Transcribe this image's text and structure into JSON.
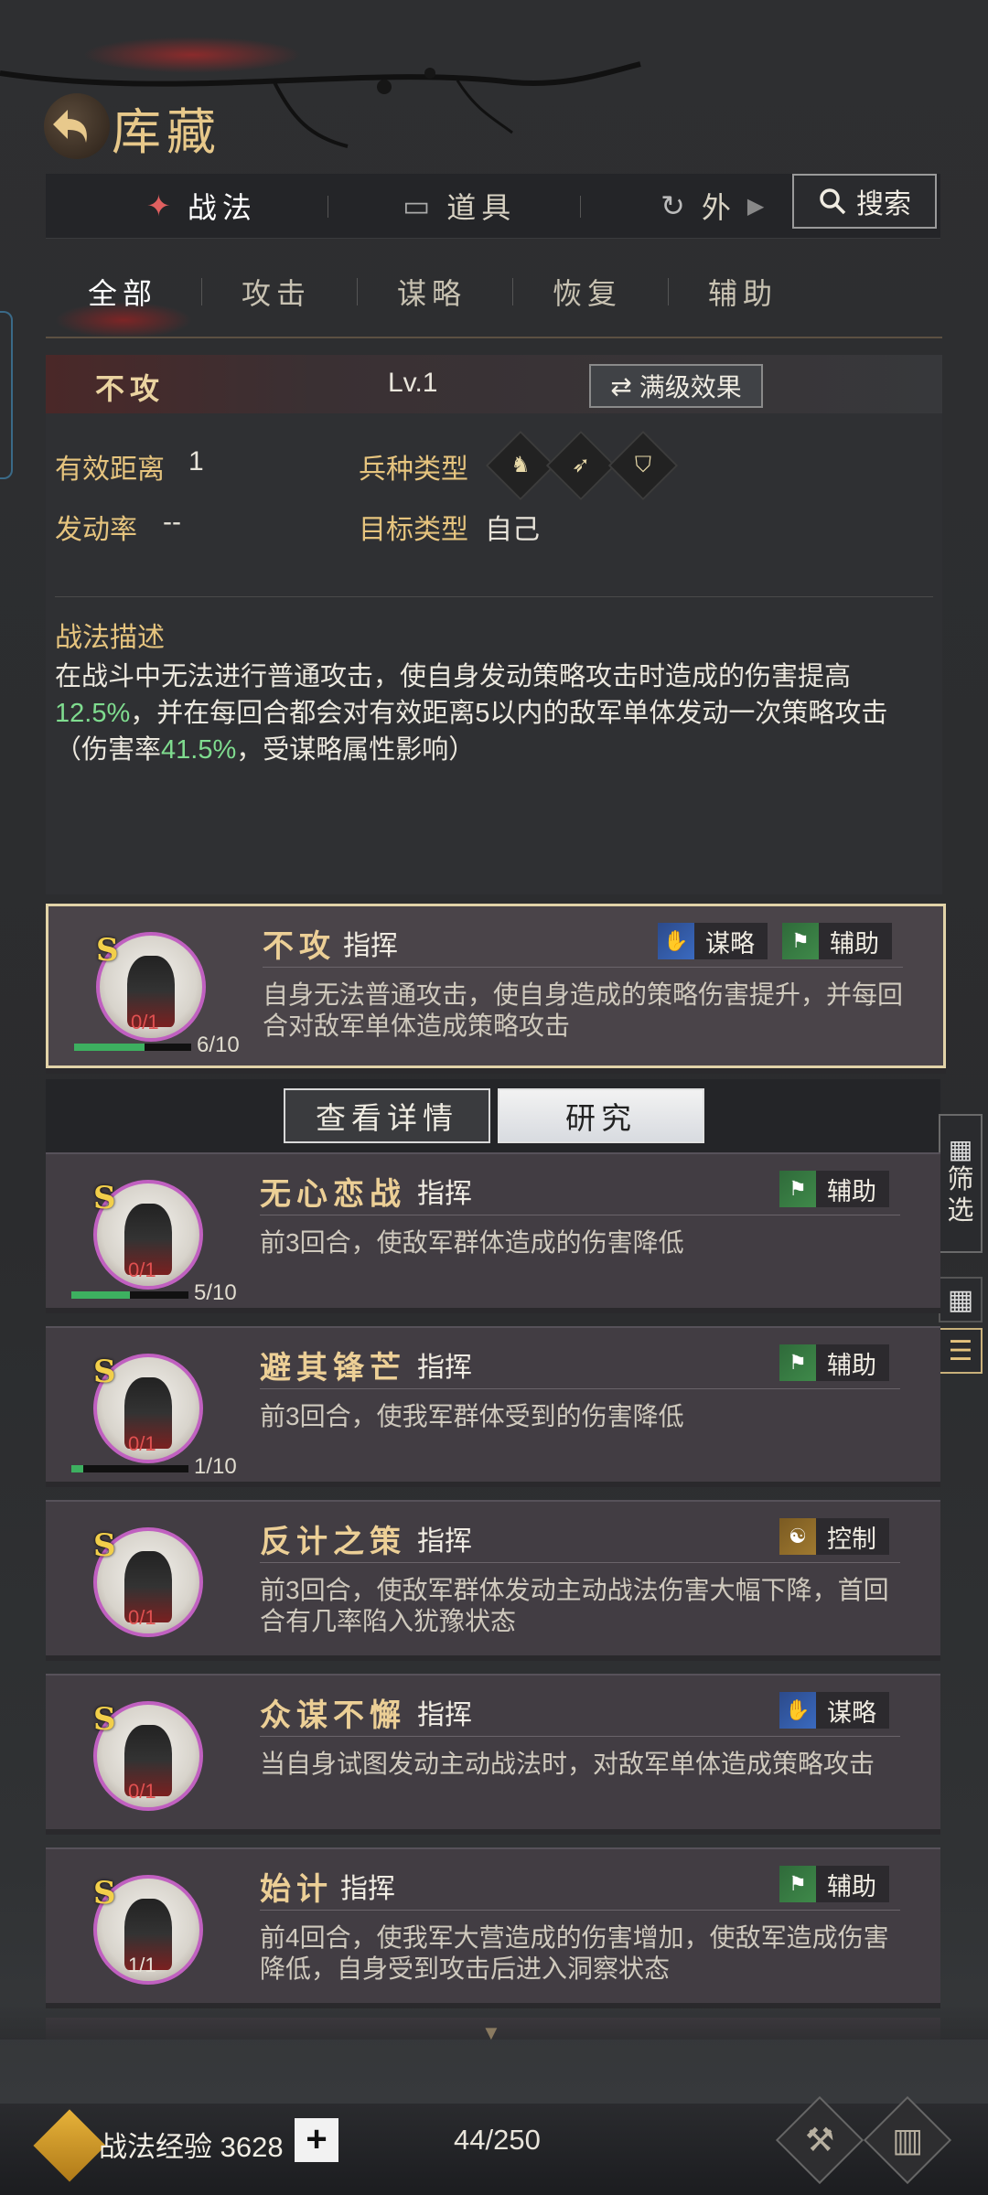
{
  "header": {
    "title": "库藏"
  },
  "tabs": [
    {
      "label": "战法",
      "icon": "scroll-icon"
    },
    {
      "label": "道具",
      "icon": "chest-icon"
    },
    {
      "label": "外",
      "icon": "cycle-icon"
    }
  ],
  "search": {
    "label": "搜索"
  },
  "subtabs": [
    "全部",
    "攻击",
    "谋略",
    "恢复",
    "辅助"
  ],
  "detail": {
    "name": "不攻",
    "level": "Lv.1",
    "max_effect": "满级效果",
    "range_label": "有效距离",
    "range_value": "1",
    "troop_label": "兵种类型",
    "rate_label": "发动率",
    "rate_value": "--",
    "target_label": "目标类型",
    "target_value": "自己",
    "desc_title": "战法描述",
    "desc_part1": "在战斗中无法进行普通攻击，使自身发动策略攻击时造成的伤害提高",
    "desc_hl1": "12.5%",
    "desc_part2": "，并在每回合都会对有效距离5以内的敌军单体发动一次策略攻击（伤害率",
    "desc_hl2": "41.5%",
    "desc_part3": "，受谋略属性影响）"
  },
  "actions": {
    "details": "查看详情",
    "research": "研究"
  },
  "filter": {
    "label": "筛选"
  },
  "cards": [
    {
      "grade": "S",
      "name": "不攻",
      "type": "指挥",
      "count": "0/1",
      "progress_label": "6/10",
      "progress": 0.6,
      "tags": [
        {
          "label": "谋略",
          "color": "blue"
        },
        {
          "label": "辅助",
          "color": "green"
        }
      ],
      "desc": "自身无法普通攻击，使自身造成的策略伤害提升，并每回合对敌军单体造成策略攻击"
    },
    {
      "grade": "S",
      "name": "无心恋战",
      "type": "指挥",
      "count": "0/1",
      "progress_label": "5/10",
      "progress": 0.5,
      "tags": [
        {
          "label": "辅助",
          "color": "green"
        }
      ],
      "desc": "前3回合，使敌军群体造成的伤害降低"
    },
    {
      "grade": "S",
      "name": "避其锋芒",
      "type": "指挥",
      "count": "0/1",
      "progress_label": "1/10",
      "progress": 0.1,
      "tags": [
        {
          "label": "辅助",
          "color": "green"
        }
      ],
      "desc": "前3回合，使我军群体受到的伤害降低"
    },
    {
      "grade": "S",
      "name": "反计之策",
      "type": "指挥",
      "count": "0/1",
      "tags": [
        {
          "label": "控制",
          "color": "gold"
        }
      ],
      "desc": "前3回合，使敌军群体发动主动战法伤害大幅下降，首回合有几率陷入犹豫状态"
    },
    {
      "grade": "S",
      "name": "众谋不懈",
      "type": "指挥",
      "count": "0/1",
      "tags": [
        {
          "label": "谋略",
          "color": "blue"
        }
      ],
      "desc": "当自身试图发动主动战法时，对敌军单体造成策略攻击"
    },
    {
      "grade": "S",
      "name": "始计",
      "type": "指挥",
      "count": "1/1",
      "tags": [
        {
          "label": "辅助",
          "color": "green"
        }
      ],
      "desc": "前4回合，使我军大营造成的伤害增加，使敌军造成伤害降低，自身受到攻击后进入洞察状态"
    }
  ],
  "bottom": {
    "exp_label": "战法经验",
    "exp_value": "3628",
    "capacity": "44/250"
  }
}
